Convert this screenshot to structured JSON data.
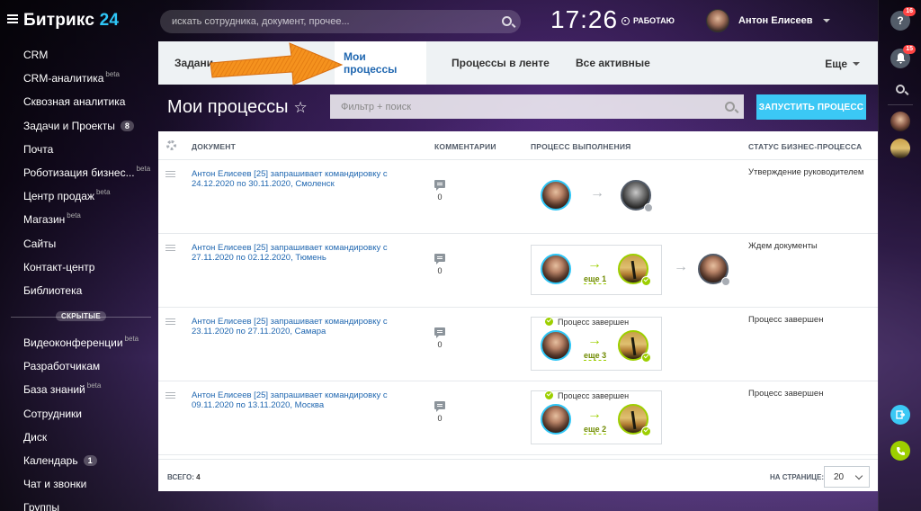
{
  "app": {
    "logo_main": "Битрикс",
    "logo_num": "24"
  },
  "header": {
    "search_placeholder": "искать сотрудника, документ, прочее...",
    "clock": "17:26",
    "work_status": "РАБОТАЮ",
    "user_name": "Антон Елисеев"
  },
  "sidebar": {
    "items": [
      {
        "label": "CRM"
      },
      {
        "label": "CRM-аналитика",
        "beta": "beta"
      },
      {
        "label": "Сквозная аналитика"
      },
      {
        "label": "Задачи и Проекты",
        "badge": "8"
      },
      {
        "label": "Почта"
      },
      {
        "label": "Роботизация бизнес...",
        "beta": "beta"
      },
      {
        "label": "Центр продаж",
        "beta": "beta"
      },
      {
        "label": "Магазин",
        "beta": "beta"
      },
      {
        "label": "Сайты"
      },
      {
        "label": "Контакт-центр"
      },
      {
        "label": "Библиотека"
      }
    ],
    "hidden_label": "СКРЫТЫЕ",
    "hidden_items": [
      {
        "label": "Видеоконференции",
        "beta": "beta"
      },
      {
        "label": "Разработчикам"
      },
      {
        "label": "База знаний",
        "beta": "beta"
      },
      {
        "label": "Сотрудники"
      },
      {
        "label": "Диск"
      },
      {
        "label": "Календарь",
        "badge": "1"
      },
      {
        "label": "Чат и звонки"
      },
      {
        "label": "Группы"
      }
    ]
  },
  "rail": {
    "help_badge": "16",
    "notify_badge": "15",
    "help_glyph": "?"
  },
  "tabs": {
    "items": [
      "Задани",
      "Мои процессы",
      "Процессы в ленте",
      "Все активные"
    ],
    "more": "Еще"
  },
  "page": {
    "title": "Мои процессы",
    "filter_placeholder": "Фильтр + поиск",
    "start_button": "ЗАПУСТИТЬ ПРОЦЕСС"
  },
  "grid": {
    "columns": {
      "document": "ДОКУМЕНТ",
      "comments": "КОММЕНТАРИИ",
      "process": "ПРОЦЕСС ВЫПОЛНЕНИЯ",
      "status": "СТАТУС БИЗНЕС-ПРОЦЕССА"
    },
    "rows": [
      {
        "doc": "Антон Елисеев [25] запрашивает командировку с 24.12.2020 по 30.11.2020, Смоленск",
        "comments": "0",
        "status": "Утверждение руководителем"
      },
      {
        "doc": "Антон Елисеев [25] запрашивает командировку с 27.11.2020 по 02.12.2020, Тюмень",
        "comments": "0",
        "status": "Ждем документы",
        "more": "еще 1"
      },
      {
        "doc": "Антон Елисеев [25] запрашивает командировку с 23.11.2020 по 27.11.2020, Самара",
        "comments": "0",
        "status": "Процесс завершен",
        "done": "Процесс завершен",
        "more": "еще 3"
      },
      {
        "doc": "Антон Елисеев [25] запрашивает командировку с 09.11.2020 по 13.11.2020, Москва",
        "comments": "0",
        "status": "Процесс завершен",
        "done": "Процесс завершен",
        "more": "еще 2"
      }
    ],
    "footer": {
      "total_label": "ВСЕГО:",
      "total": "4",
      "perpage_label": "НА СТРАНИЦЕ:",
      "perpage": "20"
    }
  },
  "colors": {
    "accent": "#2fc6f6",
    "link": "#2067b0",
    "success": "#9dcf00",
    "button": "#3bc8f5",
    "annotation_arrow": "#f5921e"
  }
}
